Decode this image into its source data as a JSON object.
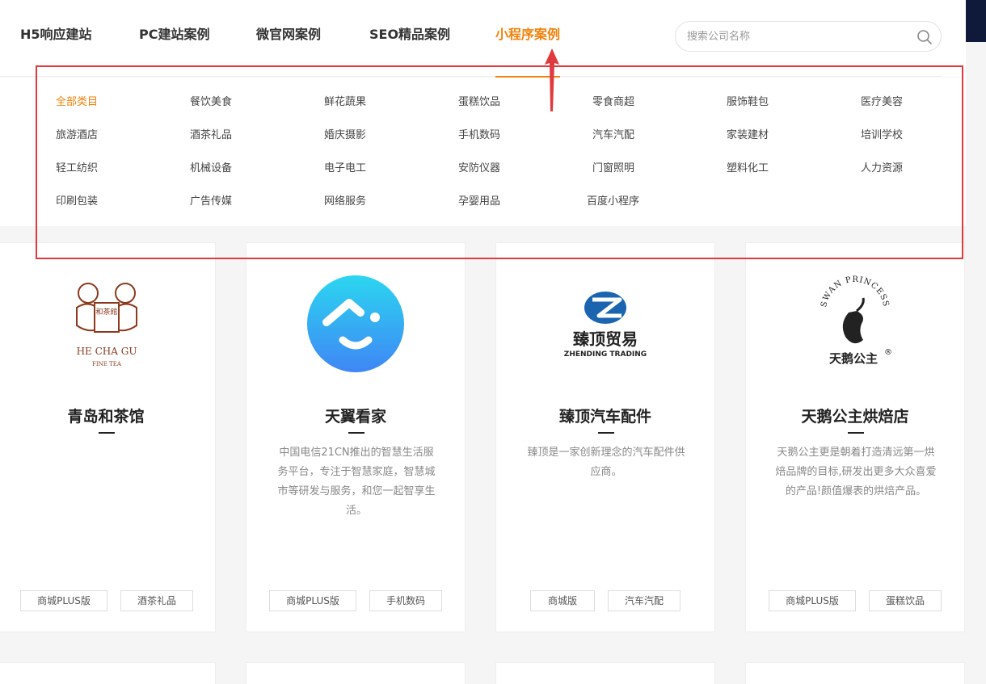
{
  "nav": {
    "items": [
      "H5响应建站",
      "PC建站案例",
      "微官网案例",
      "SEO精品案例",
      "小程序案例"
    ],
    "active_index": 4
  },
  "search": {
    "placeholder": "搜索公司名称"
  },
  "categories": [
    "全部类目",
    "餐饮美食",
    "鲜花蔬果",
    "蛋糕饮品",
    "零食商超",
    "服饰鞋包",
    "医疗美容",
    "旅游酒店",
    "酒茶礼品",
    "婚庆摄影",
    "手机数码",
    "汽车汽配",
    "家装建材",
    "培训学校",
    "轻工纺织",
    "机械设备",
    "电子电工",
    "安防仪器",
    "门窗照明",
    "塑料化工",
    "人力资源",
    "印刷包装",
    "广告传媒",
    "网络服务",
    "孕婴用品",
    "百度小程序"
  ],
  "cards": [
    {
      "title": "青岛和茶馆",
      "desc": "",
      "logo_text": {
        "badge": "和茶館",
        "brand": "HE CHA GU",
        "sub": "FINE TEA"
      },
      "tags": [
        "商城PLUS版",
        "酒茶礼品"
      ]
    },
    {
      "title": "天翼看家",
      "desc": "中国电信21CN推出的智慧生活服务平台，专注于智慧家庭，智慧城市等研发与服务，和您一起智享生活。",
      "tags": [
        "商城PLUS版",
        "手机数码"
      ]
    },
    {
      "title": "臻顶汽车配件",
      "desc": "臻顶是一家创新理念的汽车配件供应商。",
      "logo_text": {
        "cn": "臻顶贸易",
        "en": "ZHENDING TRADING"
      },
      "tags": [
        "商城版",
        "汽车汽配"
      ]
    },
    {
      "title": "天鹅公主烘焙店",
      "desc": "天鹅公主更是朝着打造清远第一烘焙品牌的目标,研发出更多大众喜爱的产品!颜值爆表的烘焙产品。",
      "logo_text": {
        "arc": "SWAN PRINCESS",
        "cn": "天鹅公主",
        "mark": "®"
      },
      "tags": [
        "商城PLUS版",
        "蛋糕饮品"
      ]
    }
  ],
  "colors": {
    "accent": "#f2820b",
    "highlight": "#e0393e",
    "logo_blue": "#1a64b0"
  }
}
